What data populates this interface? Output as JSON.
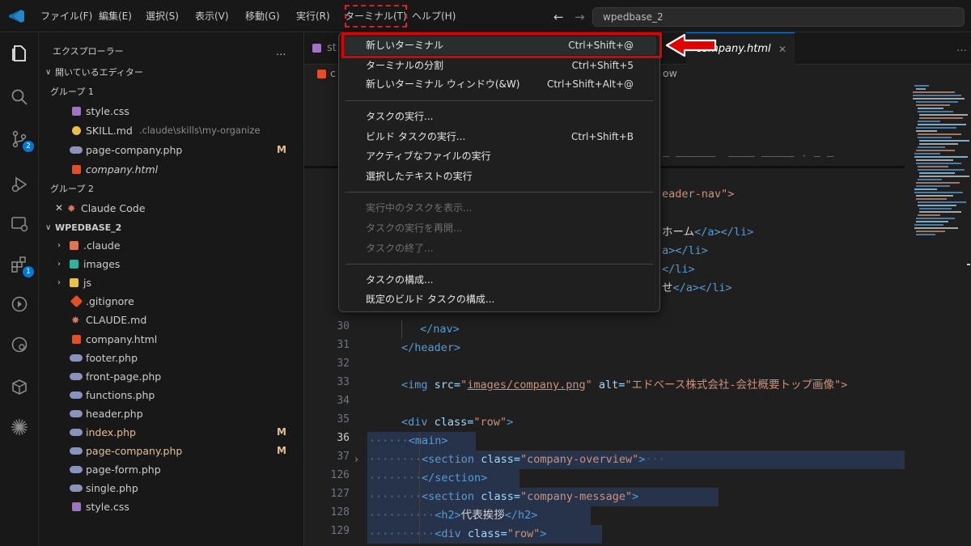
{
  "titlebar": {
    "menus": [
      "ファイル(F)",
      "編集(E)",
      "選択(S)",
      "表示(V)",
      "移動(G)",
      "実行(R)",
      "ターミナル(T)",
      "ヘルプ(H)"
    ],
    "back_icon": "←",
    "forward_icon": "→",
    "search_text": "wpedbase_2"
  },
  "sidebar": {
    "title": "エクスプローラー",
    "more": "…",
    "open_editors": "開いているエディター",
    "group1": "グループ 1",
    "group1_items": [
      {
        "name": "style.css",
        "icon": "css-icon",
        "color": "#a074c4"
      },
      {
        "name": "SKILL.md",
        "detail": ".claude\\skills\\my-organize",
        "icon": "lightbulb-icon",
        "color": "#e8c14a"
      },
      {
        "name": "page-company.php",
        "badge": "M",
        "icon": "php-icon",
        "color": "#8993be"
      },
      {
        "name": "company.html",
        "icon": "html-icon",
        "color": "#e44d26",
        "italic": true
      }
    ],
    "group2": "グループ 2",
    "group2_items": [
      {
        "name": "Claude Code",
        "close": "✕",
        "icon": "claude-icon",
        "color": "#d97757"
      }
    ],
    "workspace": "WPEDBASE_2",
    "tree": [
      {
        "name": ".claude",
        "folder": true,
        "icon": "claude-folder-icon",
        "color": "#d97757"
      },
      {
        "name": "images",
        "folder": true,
        "icon": "images-folder-icon",
        "color": "#2bb5a0"
      },
      {
        "name": "js",
        "folder": true,
        "icon": "js-folder-icon",
        "color": "#e8c14a"
      },
      {
        "name": ".gitignore",
        "icon": "git-icon",
        "color": "#e44d26"
      },
      {
        "name": "CLAUDE.md",
        "icon": "claude-icon",
        "color": "#d97757"
      },
      {
        "name": "company.html",
        "icon": "html-icon",
        "color": "#e44d26"
      },
      {
        "name": "footer.php",
        "icon": "php-icon",
        "color": "#8993be"
      },
      {
        "name": "front-page.php",
        "icon": "php-icon",
        "color": "#8993be"
      },
      {
        "name": "functions.php",
        "icon": "php-icon",
        "color": "#8993be"
      },
      {
        "name": "header.php",
        "icon": "php-icon",
        "color": "#8993be"
      },
      {
        "name": "index.php",
        "badge": "M",
        "icon": "php-icon",
        "color": "#8993be",
        "selected": true
      },
      {
        "name": "page-company.php",
        "badge": "M",
        "icon": "php-icon",
        "color": "#8993be"
      },
      {
        "name": "page-form.php",
        "icon": "php-icon",
        "color": "#8993be"
      },
      {
        "name": "single.php",
        "icon": "php-icon",
        "color": "#8993be"
      },
      {
        "name": "style.css",
        "icon": "css-icon",
        "color": "#a074c4"
      }
    ]
  },
  "activity": {
    "scm_badge": "2",
    "ext_badge": "1"
  },
  "editor": {
    "tab_left": "st",
    "tab_right": "company.html",
    "tab_right_close": "✕",
    "tabs_more": "…",
    "breadcrumb_left": "c",
    "breadcrumb_right": "ow",
    "line_numbers": [
      "1",
      "1",
      "1",
      "1",
      "2",
      "2",
      "2",
      "2",
      "2",
      "2",
      "2",
      "30",
      "31",
      "32",
      "33",
      "34",
      "35",
      "36",
      "37",
      "126",
      "127",
      "128",
      "129"
    ],
    "code": {
      "l_header_nav_attr": "eader-nav\">",
      "l_home_text": "ホーム",
      "l_home_close": "</a></li>",
      "l_r1": "a></li>",
      "l_r2": "</li>",
      "l_r3_text": "せ",
      "l_r3_tags": "</a></li>",
      "l30": "</nav>",
      "l31": "</header>",
      "l33_tag": "<img",
      "l33_attr1": " src=",
      "l33_val1_q": "\"",
      "l33_val1": "images/company.png",
      "l33_val1_q2": "\"",
      "l33_attr2": " alt=",
      "l33_val2": "\"エドベース株式会社-会社概要トップ画像\">",
      "l35_tag": "<div",
      "l35_attr": " class=",
      "l35_val": "\"row\"",
      "l35_end": ">",
      "l36": "<main>",
      "l37_tag": "<section",
      "l37_attr": " class=",
      "l37_val": "\"company-overview\"",
      "l37_end": ">",
      "l37_fold": "···",
      "l37_chev": "›",
      "l126": "</section>",
      "l127_tag": "<section",
      "l127_attr": " class=",
      "l127_val": "\"company-message\"",
      "l127_end": ">",
      "l128_open": "<h2>",
      "l128_text": "代表挨拶",
      "l128_close": "</h2>",
      "l129_tag": "<div",
      "l129_attr": " class=",
      "l129_val": "\"row\"",
      "l129_end": ">"
    }
  },
  "terminal_menu": {
    "items": [
      {
        "label": "新しいターミナル",
        "shortcut": "Ctrl+Shift+@"
      },
      {
        "label": "ターミナルの分割",
        "shortcut": "Ctrl+Shift+5"
      },
      {
        "label": "新しいターミナル ウィンドウ(&W)",
        "shortcut": "Ctrl+Shift+Alt+@"
      },
      {
        "label": "タスクの実行..."
      },
      {
        "label": "ビルド タスクの実行...",
        "shortcut": "Ctrl+Shift+B"
      },
      {
        "label": "アクティブなファイルの実行"
      },
      {
        "label": "選択したテキストの実行"
      },
      {
        "label": "実行中のタスクを表示...",
        "disabled": true
      },
      {
        "label": "タスクの実行を再開...",
        "disabled": true
      },
      {
        "label": "タスクの終了...",
        "disabled": true
      },
      {
        "label": "タスクの構成..."
      },
      {
        "label": "既定のビルド タスクの構成..."
      }
    ]
  },
  "colors": {
    "accent": "#0078d4",
    "annotation_red": "#e00000",
    "modified": "#e2c08d"
  }
}
